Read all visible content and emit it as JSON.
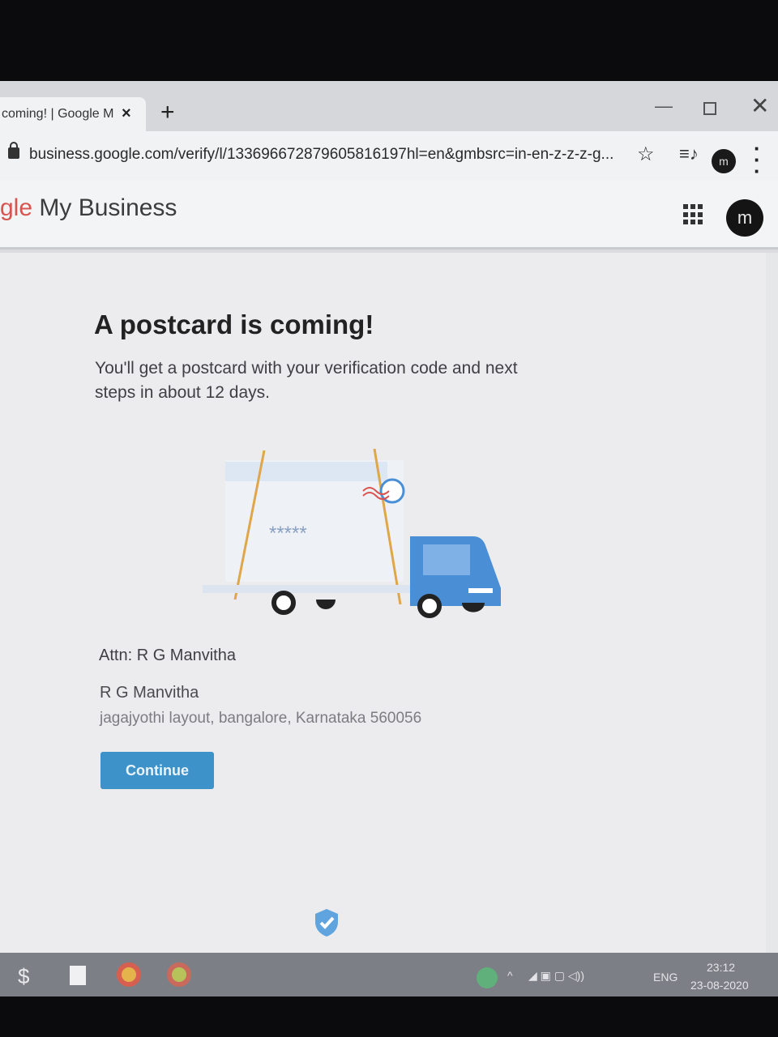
{
  "browser": {
    "tab_title": "coming! | Google M",
    "tab_close": "×",
    "new_tab": "+",
    "url": "business.google.com/verify/l/133696672879605816197hl=en&gmbsrc=in-en-z-z-z-g...",
    "profile_initial": "m"
  },
  "header": {
    "logo_prefix": "gle",
    "logo_text": " My Business",
    "avatar_initial": "m"
  },
  "main": {
    "title": "A postcard is coming!",
    "description": "You'll get a postcard with your verification code and next steps in about 12 days.",
    "code_mask": "*****",
    "attn": "Attn: R G Manvitha",
    "address_name": "R G Manvitha",
    "address_line": "jagajyothi layout, bangalore, Karnataka 560056",
    "continue_label": "Continue"
  },
  "taskbar": {
    "language": "ENG",
    "time": "23:12",
    "date": "23-08-2020"
  },
  "colors": {
    "accent": "#3d93c9",
    "truck_blue": "#4a8fd6",
    "text_dark": "#222222"
  }
}
